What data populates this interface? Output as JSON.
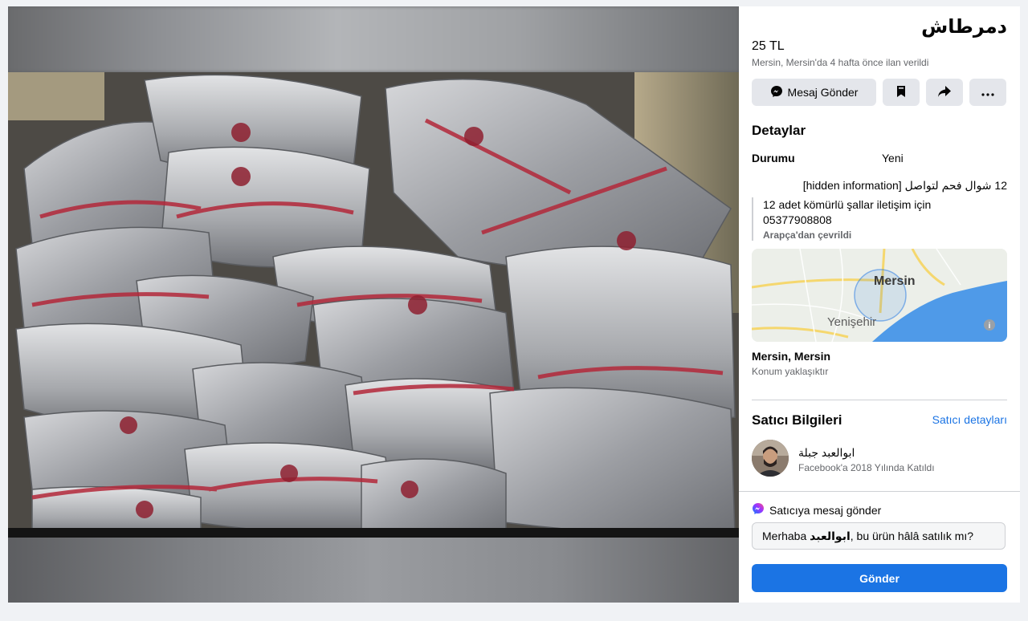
{
  "listing": {
    "title": "دمرطاش",
    "price": "25 TL",
    "listed_info": "Mersin, Mersin'da 4 hafta önce ilan verildi"
  },
  "actions": {
    "message_label": "Mesaj Gönder",
    "message_icon": "messenger-icon",
    "save_icon": "bookmark-icon",
    "share_icon": "share-icon",
    "more_icon": "more-icon"
  },
  "details": {
    "heading": "Detaylar",
    "condition_label": "Durumu",
    "condition_value": "Yeni",
    "original_description": "12 شوال فحم لتواصل [hidden information]",
    "translated_line1": "12 adet kömürlü şallar iletişim için",
    "translated_line2": "05377908808",
    "translated_note": "Arapça'dan çevrildi"
  },
  "map": {
    "city_label": "Mersin",
    "district_label": "Yenişehir",
    "water_color": "#4f9ae8",
    "road_color": "#f5d76e"
  },
  "location": {
    "name": "Mersin, Mersin",
    "note": "Konum yaklaşıktır"
  },
  "seller": {
    "heading": "Satıcı Bilgileri",
    "details_link": "Satıcı detayları",
    "name": "ابوالعبد جبلة",
    "joined": "Facebook'a 2018 Yılında Katıldı"
  },
  "send": {
    "heading": "Satıcıya mesaj gönder",
    "message_prefix": "Merhaba ",
    "message_name": "ابوالعبد",
    "message_suffix": ", bu ürün hâlâ satılık mı?",
    "button_label": "Gönder"
  },
  "colors": {
    "accent": "#1b74e4",
    "secondary_text": "#65676b"
  }
}
